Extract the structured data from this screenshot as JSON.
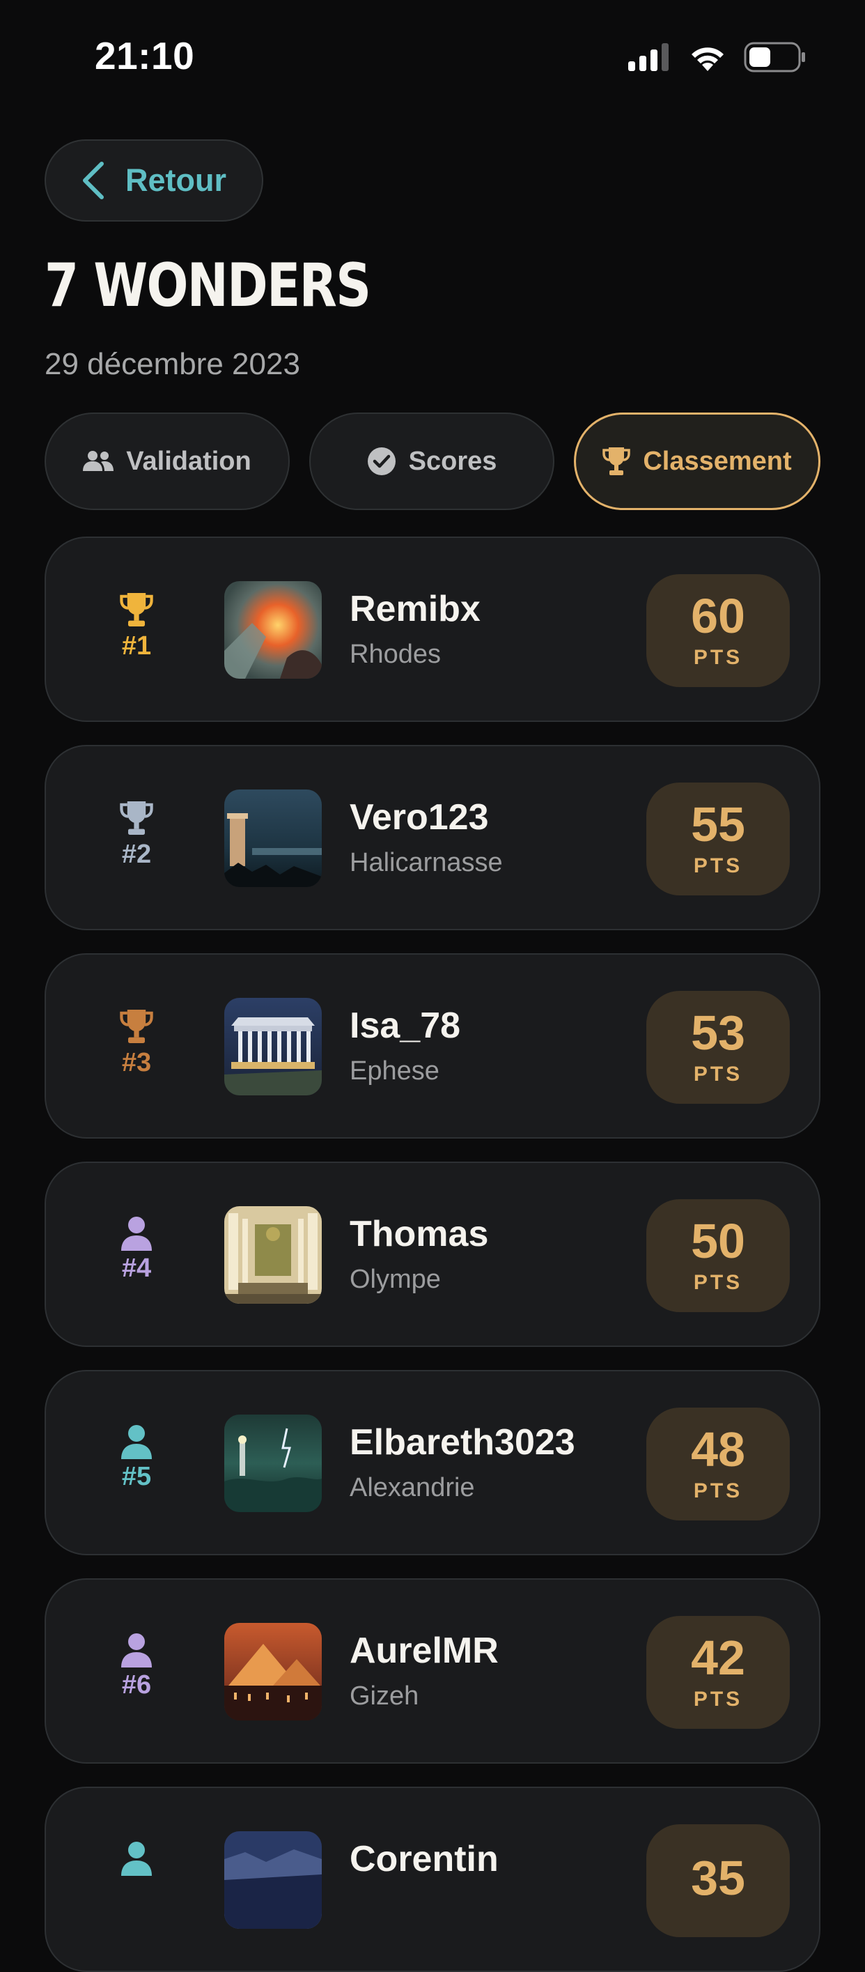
{
  "status_bar": {
    "time": "21:10",
    "icons": [
      "signal-icon",
      "wifi-icon",
      "battery-icon"
    ]
  },
  "header": {
    "back_label": "Retour",
    "title": "7 WONDERS",
    "date": "29 décembre 2023"
  },
  "tabs": [
    {
      "label": "Validation",
      "icon": "people-icon",
      "active": false
    },
    {
      "label": "Scores",
      "icon": "check-circle-icon",
      "active": false
    },
    {
      "label": "Classement",
      "icon": "trophy-icon",
      "active": true
    }
  ],
  "colors": {
    "accent_gold": "#e3b26a",
    "accent_teal": "#5fbec4",
    "silver": "#a9b6c7",
    "bronze": "#c77f3f",
    "purple": "#b9a2e0",
    "teal": "#63c1c6"
  },
  "ranking": [
    {
      "rank": "#1",
      "name": "Remibx",
      "wonder": "Rhodes",
      "points": "60",
      "unit": "PTS",
      "icon": "trophy-icon"
    },
    {
      "rank": "#2",
      "name": "Vero123",
      "wonder": "Halicarnasse",
      "points": "55",
      "unit": "PTS",
      "icon": "trophy-icon"
    },
    {
      "rank": "#3",
      "name": "Isa_78",
      "wonder": "Ephese",
      "points": "53",
      "unit": "PTS",
      "icon": "trophy-icon"
    },
    {
      "rank": "#4",
      "name": "Thomas",
      "wonder": "Olympe",
      "points": "50",
      "unit": "PTS",
      "icon": "person-icon"
    },
    {
      "rank": "#5",
      "name": "Elbareth3023",
      "wonder": "Alexandrie",
      "points": "48",
      "unit": "PTS",
      "icon": "person-icon"
    },
    {
      "rank": "#6",
      "name": "AurelMR",
      "wonder": "Gizeh",
      "points": "42",
      "unit": "PTS",
      "icon": "person-icon"
    },
    {
      "rank": "",
      "name": "Corentin",
      "wonder": "",
      "points": "35",
      "unit": "",
      "icon": "person-icon"
    }
  ]
}
